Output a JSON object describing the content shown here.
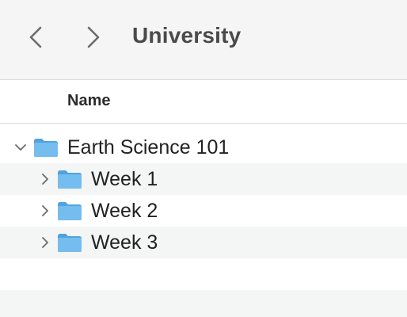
{
  "toolbar": {
    "back_icon": "chevron-left-icon",
    "forward_icon": "chevron-right-icon",
    "title": "University"
  },
  "columns": {
    "name": "Name"
  },
  "tree": {
    "root": {
      "label": "Earth Science 101",
      "expanded": true,
      "icon": "folder-icon"
    },
    "children": [
      {
        "label": "Week 1",
        "expanded": false,
        "icon": "folder-icon"
      },
      {
        "label": "Week 2",
        "expanded": false,
        "icon": "folder-icon"
      },
      {
        "label": "Week 3",
        "expanded": false,
        "icon": "folder-icon"
      }
    ]
  },
  "colors": {
    "folder": "#6cb6ea",
    "toolbar_bg": "#f5f5f5",
    "alt_row": "#f4f5f5"
  }
}
